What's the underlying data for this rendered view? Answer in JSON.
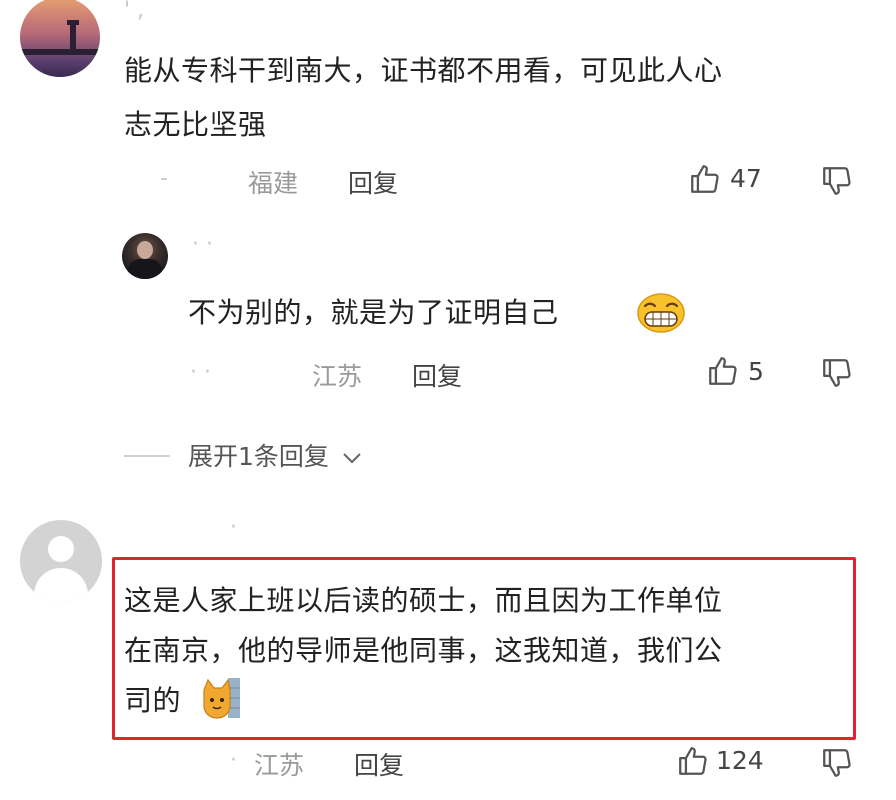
{
  "comments": [
    {
      "username": "' ,",
      "text_line1": "能从专科干到南大，证书都不用看，可见此人心",
      "text_line2": "志无比坚强",
      "time": "-",
      "location": "福建",
      "reply_label": "回复",
      "likes": "47"
    },
    {
      "username": "· ·",
      "text": "不为别的，就是为了证明自己",
      "time": "· ·",
      "location": "江苏",
      "reply_label": "回复",
      "likes": "5"
    },
    {
      "expand_label": "展开1条回复"
    },
    {
      "username": "·",
      "text_line1": "这是人家上班以后读的硕士，而且因为工作单位",
      "text_line2": "在南京，他的导师是他同事，这我知道，我们公",
      "text_line3": "司的",
      "time": "·",
      "location": "江苏",
      "reply_label": "回复",
      "likes": "124",
      "highlight_color": "#e0262a"
    }
  ],
  "icons": {
    "like": "thumbs-up-icon",
    "dislike": "thumbs-down-icon",
    "expand": "chevron-down-icon",
    "grin": "grinning-emoji",
    "cat": "cat-emoji"
  }
}
